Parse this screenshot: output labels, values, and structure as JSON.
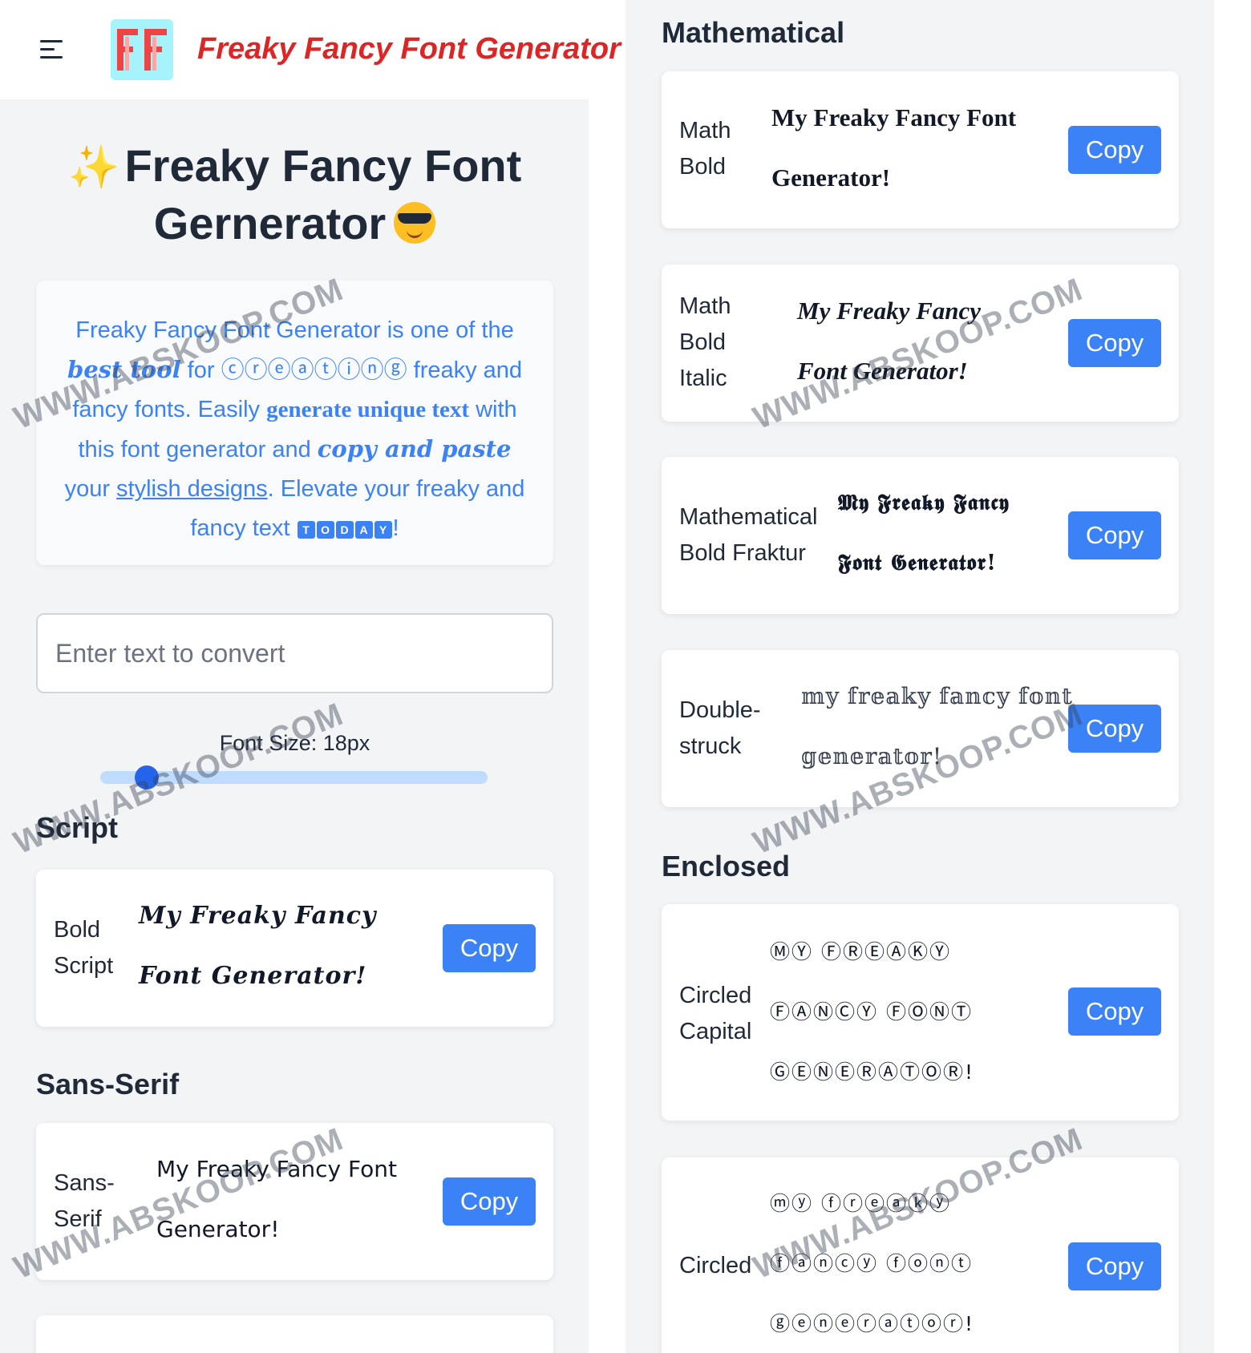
{
  "header": {
    "brand_title": "Freaky Fancy Font Generator"
  },
  "hero": {
    "title_line1": "Freaky Fancy Font",
    "title_line2": "Gernerator"
  },
  "intro": {
    "p1": "Freaky Fancy Font Generator is one of the",
    "p2": "best tool",
    "p3": " for ",
    "p4": "ⓒⓡⓔⓐⓣⓘⓝⓖ",
    "p5": " freaky and fancy fonts. Easily ",
    "p6": "generate unique text",
    "p7": " with this font generator and ",
    "p8": "copy and paste",
    "p9": " your ",
    "p10": "stylish designs",
    "p11": ". Elevate your freaky and fancy text ",
    "today_letters": [
      "T",
      "O",
      "D",
      "A",
      "Y"
    ],
    "p12": "!"
  },
  "input": {
    "placeholder": "Enter text to convert",
    "value": ""
  },
  "font_size": {
    "label": "Font Size: 18px",
    "fraction": 0.12
  },
  "left_sections": [
    {
      "heading": "Script",
      "cards": [
        {
          "label_line1": "Bold",
          "label_line2": "Script",
          "sample_line1": "My Freaky Fancy",
          "sample_line2": "Font Generator!",
          "button": "Copy"
        }
      ]
    },
    {
      "heading": "Sans-Serif",
      "cards": [
        {
          "label_line1": "Sans-",
          "label_line2": "Serif",
          "sample_line1": "My Freaky Fancy Font",
          "sample_line2": "Generator!",
          "button": "Copy"
        }
      ]
    }
  ],
  "right_sections": [
    {
      "heading": "Mathematical",
      "cards": [
        {
          "label_line1": "Math",
          "label_line2": "Bold",
          "sample_line1": "My Freaky Fancy Font",
          "sample_line2": "Generator!",
          "button": "Copy"
        },
        {
          "label_line1": "Math",
          "label_line2": "Bold",
          "label_line3": "Italic",
          "sample_line1": "My Freaky Fancy",
          "sample_line2": "Font Generator!",
          "button": "Copy"
        },
        {
          "label_line1": "Mathematical",
          "label_line2": "Bold Fraktur",
          "sample_line1": "𝕸𝖞 𝕱𝖗𝖊𝖆𝖐𝖞 𝕱𝖆𝖓𝖈𝖞",
          "sample_line2": "𝕱𝖔𝖓𝖙 𝕲𝖊𝖓𝖊𝖗𝖆𝖙𝖔𝖗!",
          "button": "Copy"
        },
        {
          "label_line1": "Double-",
          "label_line2": "struck",
          "sample_line1": "𝕞𝕪 𝕗𝕣𝕖𝕒𝕜𝕪 𝕗𝕒𝕟𝕔𝕪 𝕗𝕠𝕟𝕥",
          "sample_line2": "𝕘𝕖𝕟𝕖𝕣𝕒𝕥𝕠𝕣!",
          "button": "Copy"
        }
      ]
    },
    {
      "heading": "Enclosed",
      "cards": [
        {
          "label_line1": "Circled",
          "label_line2": "Capital",
          "sample_line1": "ⓂⓎ ⒻⓇⒺⒶⓀⓎ",
          "sample_line2": "ⒻⒶⓃⒸⓎ ⒻⓄⓃⓉ",
          "sample_line3": "ⒼⒺⓃⒺⓇⒶⓉⓄⓇ!",
          "button": "Copy"
        },
        {
          "label_line1": "Circled",
          "sample_line1": "ⓜⓨ ⓕⓡⓔⓐⓚⓨ",
          "sample_line2": "ⓕⓐⓝⓒⓨ ⓕⓞⓝⓣ",
          "sample_line3": "ⓖⓔⓝⓔⓡⓐⓣⓞⓡ!",
          "button": "Copy"
        }
      ]
    }
  ],
  "watermark": "WWW.ABSKOOP.COM",
  "colors": {
    "brand_red": "#dc2626",
    "accent_blue": "#3b82f6",
    "background_gray": "#f3f4f6"
  }
}
